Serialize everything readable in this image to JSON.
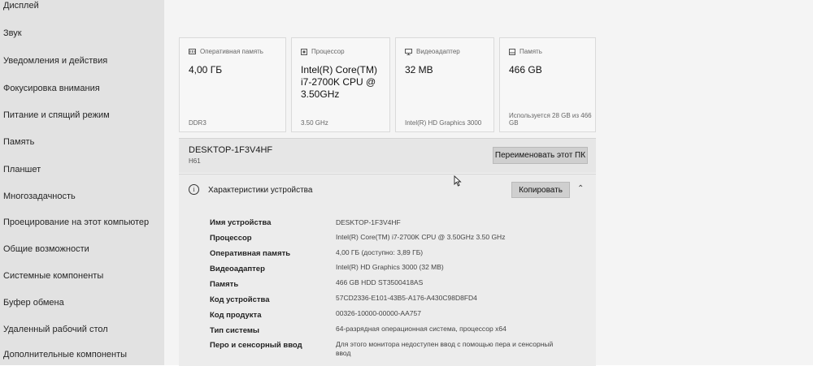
{
  "sidebar": {
    "items": [
      {
        "label": "Дисплей"
      },
      {
        "label": "Звук"
      },
      {
        "label": "Уведомления и действия"
      },
      {
        "label": "Фокусировка внимания"
      },
      {
        "label": "Питание и спящий режим"
      },
      {
        "label": "Память"
      },
      {
        "label": "Планшет"
      },
      {
        "label": "Многозадачность"
      },
      {
        "label": "Проецирование на этот компьютер"
      },
      {
        "label": "Общие возможности"
      },
      {
        "label": "Системные компоненты"
      },
      {
        "label": "Буфер обмена"
      },
      {
        "label": "Удаленный рабочий стол"
      },
      {
        "label": "Дополнительные компоненты"
      }
    ]
  },
  "tiles": [
    {
      "title": "Оперативная память",
      "icon": "ram-icon",
      "value": "4,00 ГБ",
      "footer": "DDR3"
    },
    {
      "title": "Процессор",
      "icon": "cpu-icon",
      "value_lines": [
        "Intel(R) Core(TM)",
        "i7-2700K CPU @",
        "3.50GHz"
      ],
      "footer": "3.50 GHz"
    },
    {
      "title": "Видеоадаптер",
      "icon": "display-icon",
      "value": "32 MB",
      "footer": "Intel(R) HD Graphics 3000"
    },
    {
      "title": "Память",
      "icon": "storage-icon",
      "value": "466 GB",
      "footer_lines": [
        "Используется 28 GB из 466",
        "GB"
      ]
    }
  ],
  "pc": {
    "name": "DESKTOP-1F3V4HF",
    "board": "H61",
    "rename_label": "Переименовать этот ПК"
  },
  "specs": {
    "title": "Характеристики устройства",
    "copy_label": "Копировать",
    "rows": [
      {
        "label": "Имя устройства",
        "value": "DESKTOP-1F3V4HF"
      },
      {
        "label": "Процессор",
        "value": "Intel(R) Core(TM) i7-2700K CPU @ 3.50GHz   3.50 GHz"
      },
      {
        "label": "Оперативная память",
        "value": "4,00 ГБ (доступно: 3,89 ГБ)"
      },
      {
        "label": "Видеоадаптер",
        "value": "Intel(R) HD Graphics 3000 (32 MB)"
      },
      {
        "label": "Память",
        "value": "466 GB HDD ST3500418AS"
      },
      {
        "label": "Код устройства",
        "value": "57CD2336-E101-43B5-A176-A430C98D8FD4"
      },
      {
        "label": "Код продукта",
        "value": "00326-10000-00000-AA757"
      },
      {
        "label": "Тип системы",
        "value": "64-разрядная операционная система, процессор x64"
      },
      {
        "label": "Перо и сенсорный ввод",
        "value_lines": [
          "Для этого монитора недоступен ввод с помощью пера и сенсорный",
          "ввод"
        ]
      }
    ]
  }
}
